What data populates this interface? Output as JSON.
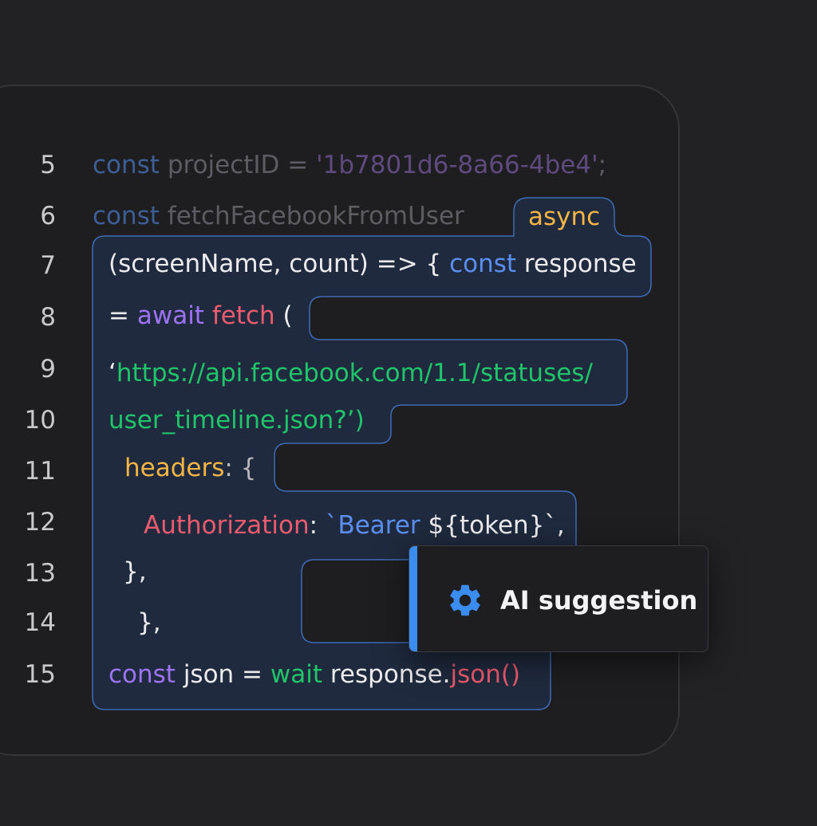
{
  "lines": [
    {
      "number": "5",
      "tokens": [
        {
          "t": "const",
          "c": "c-kw-dim"
        },
        {
          "t": " projectID = ",
          "c": "c-id-dim"
        },
        {
          "t": "'1b7801d6-8a66-4be4'",
          "c": "c-str-dim"
        },
        {
          "t": ";",
          "c": "c-id-dim"
        }
      ]
    },
    {
      "number": "6",
      "tokens": [
        {
          "t": "const",
          "c": "c-kw-dim"
        },
        {
          "t": " fetchFacebookFromUser",
          "c": "c-id-dim"
        }
      ]
    },
    {
      "number": "7",
      "tokens": [
        {
          "t": "(screenName, count) => { ",
          "c": "c-white"
        },
        {
          "t": "const",
          "c": "c-kw"
        },
        {
          "t": " response",
          "c": "c-white"
        }
      ]
    },
    {
      "number": "8",
      "tokens": [
        {
          "t": "= ",
          "c": "c-white"
        },
        {
          "t": "await",
          "c": "c-purple"
        },
        {
          "t": " ",
          "c": "c-white"
        },
        {
          "t": "fetch",
          "c": "c-red"
        },
        {
          "t": " (",
          "c": "c-white"
        }
      ]
    },
    {
      "number": "9",
      "tokens": [
        {
          "t": "‘",
          "c": "c-white"
        },
        {
          "t": "https://api.facebook.com/1.1/statuses/",
          "c": "c-green"
        }
      ]
    },
    {
      "number": "10",
      "tokens": [
        {
          "t": "user_timeline.json?’)",
          "c": "c-green"
        }
      ]
    },
    {
      "number": "11",
      "tokens": [
        {
          "t": "headers",
          "c": "c-orange"
        },
        {
          "t": ": {",
          "c": "c-gray"
        }
      ]
    },
    {
      "number": "12",
      "tokens": [
        {
          "t": "Authorization",
          "c": "c-red"
        },
        {
          "t": ": ",
          "c": "c-white"
        },
        {
          "t": "`Bearer",
          "c": "c-kw"
        },
        {
          "t": " ${token}`,",
          "c": "c-white"
        }
      ]
    },
    {
      "number": "13",
      "tokens": [
        {
          "t": "},",
          "c": "c-white"
        }
      ]
    },
    {
      "number": "14",
      "tokens": [
        {
          "t": "},",
          "c": "c-white"
        }
      ]
    },
    {
      "number": "15",
      "tokens": [
        {
          "t": "const",
          "c": "c-purple"
        },
        {
          "t": " json = ",
          "c": "c-white"
        },
        {
          "t": "wait",
          "c": "c-green"
        },
        {
          "t": " response.",
          "c": "c-white"
        },
        {
          "t": "json()",
          "c": "c-red"
        }
      ]
    }
  ],
  "async_badge": "async",
  "suggestion": {
    "icon": "gear-icon",
    "label": "AI suggestion"
  },
  "colors": {
    "background": "#222224",
    "panel": "#1e1e20",
    "highlight_fill": "#1f2a3e",
    "highlight_border": "#3e6bb6",
    "accent": "#3b8cf0"
  }
}
